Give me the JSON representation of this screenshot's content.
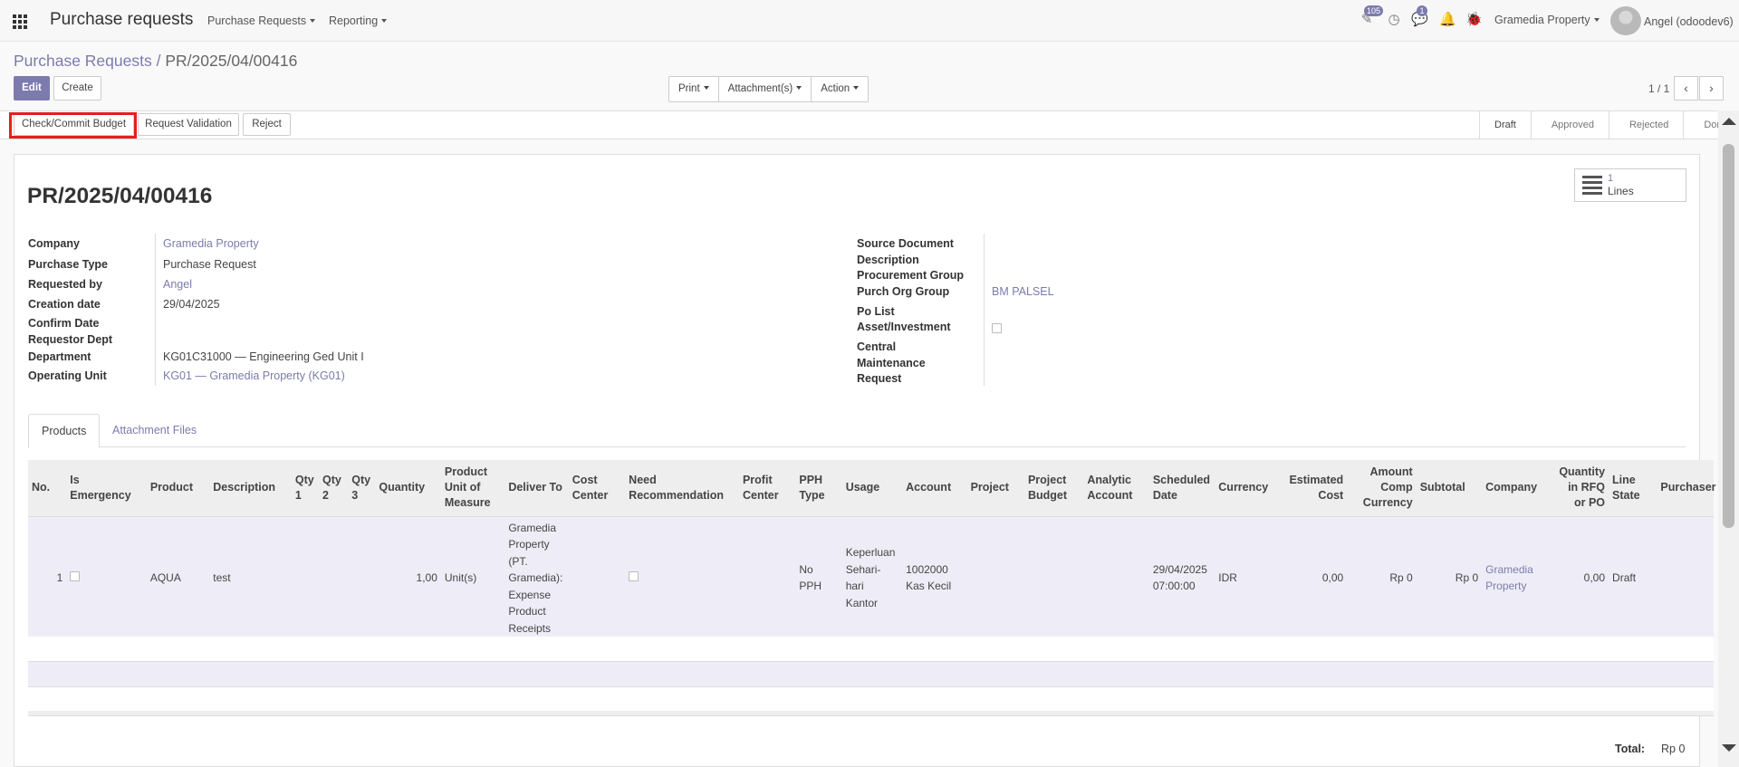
{
  "topbar": {
    "app_title": "Purchase requests",
    "menus": [
      "Purchase Requests",
      "Reporting"
    ],
    "activity_badge": "105",
    "chat_badge": "1",
    "company": "Gramedia Property",
    "user": "Angel (odoodev6)"
  },
  "breadcrumb": {
    "parent": "Purchase Requests",
    "separator": "/",
    "current": "PR/2025/04/00416"
  },
  "control": {
    "edit": "Edit",
    "create": "Create",
    "print": "Print",
    "attachments": "Attachment(s)",
    "action": "Action",
    "pager": "1 / 1"
  },
  "statusbar": {
    "buttons": [
      "Check/Commit Budget",
      "Request Validation",
      "Reject"
    ],
    "stages": [
      "Draft",
      "Approved",
      "Rejected",
      "Done"
    ],
    "active_stage": "Draft"
  },
  "smart_button": {
    "count": "1",
    "label": "Lines"
  },
  "record": {
    "name": "PR/2025/04/00416",
    "left_fields": [
      {
        "label": "Company",
        "value": "Gramedia Property"
      },
      {
        "label": "Purchase Type",
        "value": "Purchase Request"
      },
      {
        "label": "Requested by",
        "value": "Angel"
      },
      {
        "label": "Creation date",
        "value": "29/04/2025"
      },
      {
        "label": "Confirm Date",
        "value": ""
      },
      {
        "label": "Requestor Dept",
        "value": ""
      },
      {
        "label": "Department",
        "value": "KG01C31000 — Engineering Ged Unit I"
      },
      {
        "label": "Operating Unit",
        "value": "KG01 — Gramedia Property (KG01)"
      }
    ],
    "right_fields": [
      {
        "label": "Source Document",
        "value": ""
      },
      {
        "label": "Description",
        "value": ""
      },
      {
        "label": "Procurement Group",
        "value": ""
      },
      {
        "label": "Purch Org Group",
        "value": "BM PALSEL"
      },
      {
        "label": "Po List",
        "value": ""
      },
      {
        "label": "Asset/Investment",
        "value": ""
      },
      {
        "label": "Central Maintenance Request",
        "value": ""
      }
    ]
  },
  "tabs": [
    "Products",
    "Attachment Files"
  ],
  "table": {
    "headers": [
      "No.",
      "Is Emergency",
      "Product",
      "Description",
      "Qty 1",
      "Qty 2",
      "Qty 3",
      "Quantity",
      "Product Unit of Measure",
      "Deliver To",
      "Cost Center",
      "Need Recommendation",
      "Profit Center",
      "PPH Type",
      "Usage",
      "Account",
      "Project",
      "Project Budget",
      "Analytic Account",
      "Scheduled Date",
      "Currency",
      "Estimated Cost",
      "Amount Comp Currency",
      "Subtotal",
      "Company",
      "Quantity in RFQ or PO",
      "Line State",
      "Purchaser"
    ],
    "rows": [
      {
        "no": "1",
        "product": "AQUA",
        "description": "test",
        "qty1": "",
        "qty2": "",
        "qty3": "",
        "quantity": "1,00",
        "uom": "Unit(s)",
        "deliver_to": "Gramedia Property (PT. Gramedia): Expense Product Receipts",
        "cost_center": "",
        "profit_center": "",
        "pph_type": "No PPH",
        "usage": "Keperluan Sehari-hari Kantor",
        "account": "1002000 Kas Kecil",
        "project": "",
        "project_budget": "",
        "analytic_account": "",
        "scheduled_date": "29/04/2025 07:00:00",
        "currency": "IDR",
        "estimated_cost": "0,00",
        "amount_comp": "Rp 0",
        "subtotal": "Rp 0",
        "company": "Gramedia Property",
        "qty_rfq": "0,00",
        "line_state": "Draft",
        "purchaser": ""
      }
    ]
  },
  "totals": {
    "label": "Total:",
    "value": "Rp 0"
  },
  "colors": {
    "accent": "#7c7bad",
    "highlight": "#e0201e"
  }
}
